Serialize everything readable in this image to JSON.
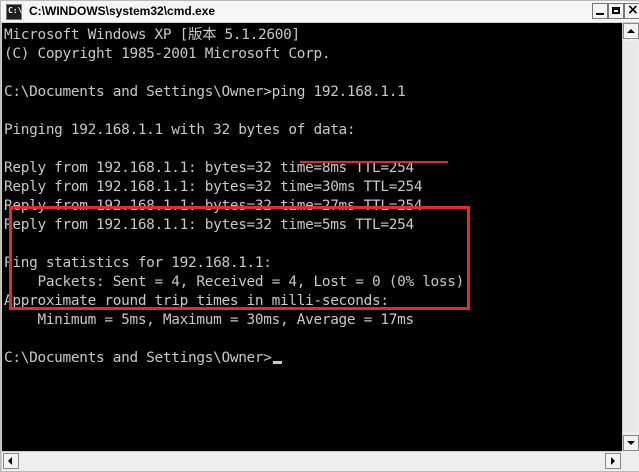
{
  "window": {
    "title": "C:\\WINDOWS\\system32\\cmd.exe",
    "icons": [
      "cmd-app-icon",
      "minimize-icon",
      "maximize-icon",
      "close-icon"
    ]
  },
  "console": {
    "lines": [
      "Microsoft Windows XP [版本 5.1.2600]",
      "(C) Copyright 1985-2001 Microsoft Corp.",
      "",
      "C:\\Documents and Settings\\Owner>ping 192.168.1.1",
      "",
      "Pinging 192.168.1.1 with 32 bytes of data:",
      "",
      "Reply from 192.168.1.1: bytes=32 time=8ms TTL=254",
      "Reply from 192.168.1.1: bytes=32 time=30ms TTL=254",
      "Reply from 192.168.1.1: bytes=32 time=27ms TTL=254",
      "Reply from 192.168.1.1: bytes=32 time=5ms TTL=254",
      "",
      "Ping statistics for 192.168.1.1:",
      "    Packets: Sent = 4, Received = 4, Lost = 0 (0% loss),",
      "Approximate round trip times in milli-seconds:",
      "    Minimum = 5ms, Maximum = 30ms, Average = 17ms",
      "",
      "C:\\Documents and Settings\\Owner>"
    ]
  },
  "colors": {
    "console_background": "#000000",
    "console_text": "#c8c8c8",
    "annotation_red": "#e42b2c"
  }
}
